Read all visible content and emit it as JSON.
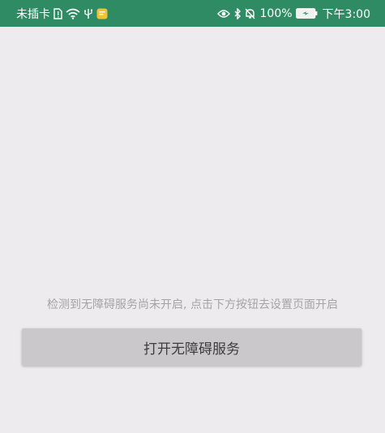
{
  "status_bar": {
    "carrier": "未插卡",
    "battery_percent": "100%",
    "time": "下午3:00",
    "background_color": "#2e8b63",
    "icons_left": [
      "sim-alert-icon",
      "wifi-icon",
      "usb-icon",
      "notification-app-icon"
    ],
    "icons_right": [
      "eye-icon",
      "bluetooth-icon",
      "mute-bell-icon",
      "battery-charging-icon"
    ]
  },
  "main": {
    "hint_text": "检测到无障碍服务尚未开启, 点击下方按钮去设置页面开启",
    "button_label": "打开无障碍服务",
    "button_color": "#cac8ca"
  }
}
